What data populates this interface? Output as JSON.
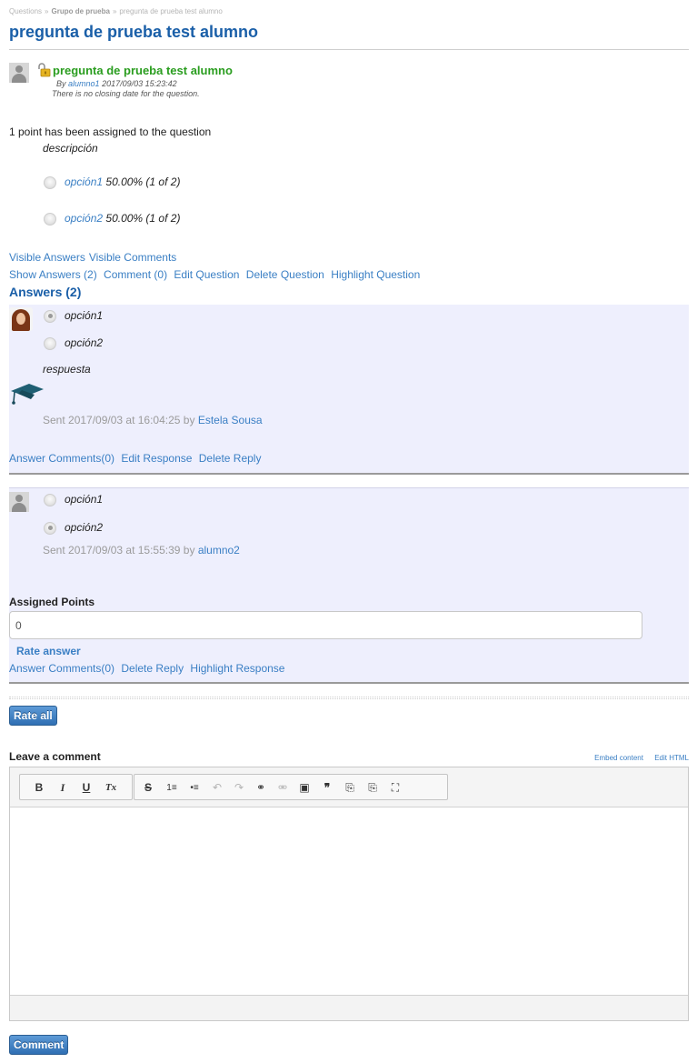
{
  "breadcrumb": {
    "items": [
      "Questions",
      "Grupo de prueba",
      "pregunta de prueba test alumno"
    ],
    "separator": "»"
  },
  "page_title": "pregunta de prueba test alumno",
  "question": {
    "title": "pregunta de prueba test alumno",
    "by_prefix": "By",
    "author": "alumno1",
    "datetime": "2017/09/03 15:23:42",
    "closing_note": "There is no closing date for the question.",
    "points_text": "1 point has been assigned to the question",
    "description": "descripción",
    "options": [
      {
        "label": "opción1",
        "stat": "50.00% (1 of 2)"
      },
      {
        "label": "opción2",
        "stat": "50.00% (1 of 2)"
      }
    ]
  },
  "visibility_links": [
    "Visible Answers",
    "Visible Comments"
  ],
  "question_actions": [
    "Show Answers (2)",
    "Comment (0)",
    "Edit Question",
    "Delete Question",
    "Highlight Question"
  ],
  "answers_heading": "Answers (2)",
  "answers": [
    {
      "options": [
        "opción1",
        "opción2"
      ],
      "selected": 0,
      "response": "respuesta",
      "sent_text": "Sent 2017/09/03 at 16:04:25 by",
      "sender": "Estela Sousa",
      "actions": [
        "Answer Comments(0)",
        "Edit Response",
        "Delete Reply"
      ]
    },
    {
      "options": [
        "opción1",
        "opción2"
      ],
      "selected": 1,
      "sent_text": "Sent 2017/09/03 at 15:55:39 by",
      "sender": "alumno2",
      "assigned_points_label": "Assigned Points",
      "assigned_points_value": "0",
      "rate_answer_label": "Rate answer",
      "actions": [
        "Answer Comments(0)",
        "Delete Reply",
        "Highlight Response"
      ]
    }
  ],
  "rate_all_label": "Rate all",
  "comment": {
    "heading": "Leave a comment",
    "embed_link": "Embed content",
    "edit_html_link": "Edit HTML",
    "toolbar": {
      "bold": "B",
      "italic": "I",
      "underline": "U",
      "clear_format": "Tx",
      "strike": "S",
      "ordered_list": "1≡",
      "bullet_list": "•≡",
      "undo": "↶",
      "redo": "↷",
      "link": "⚭",
      "unlink": "⚮",
      "image": "▣",
      "quote": "❞",
      "paste_text": "⎘",
      "paste_word": "⎘",
      "fullscreen": "⛶"
    },
    "submit_label": "Comment"
  },
  "colors": {
    "link": "#3a7fc4",
    "title": "#1a5fa8",
    "question_title": "#2a9d1f",
    "answer_bg": "#eeeffd",
    "button": "#2f6fb3"
  }
}
